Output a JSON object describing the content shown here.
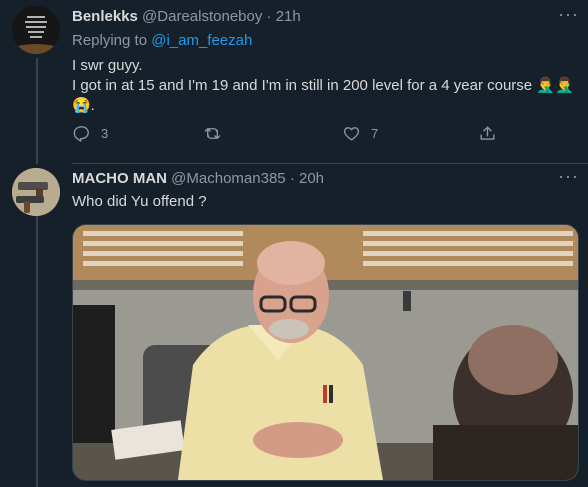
{
  "tweet1": {
    "author_name": "Benlekks",
    "author_handle": "@Darealstoneboy",
    "separator": "·",
    "time": "21h",
    "replying_prefix": "Replying to",
    "replying_handle": "@i_am_feezah",
    "line1": "I swr guyy.",
    "line2": "I got in at 15 and I'm 19 and I'm in still in 200 level for a 4 year course 🤦‍♂️🤦‍♂️",
    "line3": "😭.",
    "reply_count": "3",
    "retweet_count": "",
    "like_count": "7"
  },
  "tweet2": {
    "author_name": "MACHO MAN",
    "author_handle": "@Machoman385",
    "separator": "·",
    "time": "20h",
    "text": "Who did Yu offend ?"
  },
  "more_label": "···",
  "icons": {
    "reply": "reply-icon",
    "retweet": "retweet-icon",
    "like": "heart-icon",
    "share": "share-icon",
    "more": "more-icon"
  }
}
